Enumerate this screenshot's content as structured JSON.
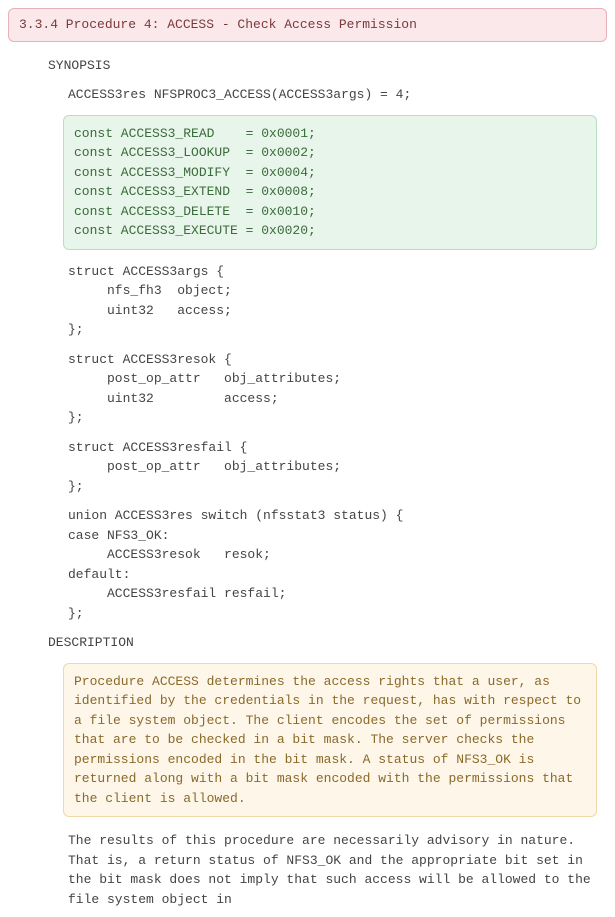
{
  "header": "3.3.4 Procedure 4: ACCESS - Check Access Permission",
  "synopsis_label": "SYNOPSIS",
  "sig_line": "ACCESS3res NFSPROC3_ACCESS(ACCESS3args) = 4;",
  "constants": "const ACCESS3_READ    = 0x0001;\nconst ACCESS3_LOOKUP  = 0x0002;\nconst ACCESS3_MODIFY  = 0x0004;\nconst ACCESS3_EXTEND  = 0x0008;\nconst ACCESS3_DELETE  = 0x0010;\nconst ACCESS3_EXECUTE = 0x0020;",
  "struct_args": "struct ACCESS3args {\n     nfs_fh3  object;\n     uint32   access;\n};",
  "struct_resok": "struct ACCESS3resok {\n     post_op_attr   obj_attributes;\n     uint32         access;\n};",
  "struct_resfail": "struct ACCESS3resfail {\n     post_op_attr   obj_attributes;\n};",
  "union_res": "union ACCESS3res switch (nfsstat3 status) {\ncase NFS3_OK:\n     ACCESS3resok   resok;\ndefault:\n     ACCESS3resfail resfail;\n};",
  "description_label": "DESCRIPTION",
  "description_box": "Procedure ACCESS determines the access rights that a user, as identified by the credentials in the request, has with respect to a file system object. The client encodes the set of permissions that are to be checked in a bit mask. The server checks the permissions encoded in the bit mask. A status of NFS3_OK is returned along with a bit mask encoded with the permissions that the client is allowed.",
  "body1": "The results of this procedure are necessarily advisory in nature.  That is, a return status of NFS3_OK and the appropriate bit set in the bit mask does not imply that such access will be allowed to the file system object in"
}
